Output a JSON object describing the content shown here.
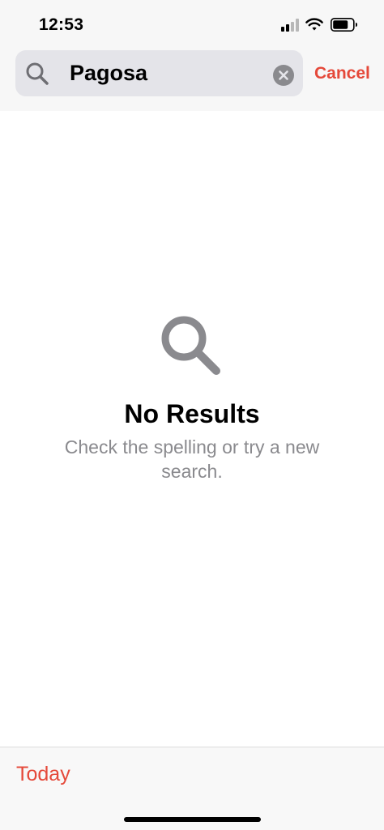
{
  "status_bar": {
    "time": "12:53"
  },
  "search": {
    "query": "Pagosa",
    "cancel_label": "Cancel"
  },
  "empty_state": {
    "icon": "search-icon",
    "title": "No Results",
    "message": "Check the spelling or try a new search."
  },
  "toolbar": {
    "today_label": "Today"
  },
  "colors": {
    "accent": "#e5493a",
    "secondary_text": "#8a8a8e",
    "search_field_bg": "#e4e4e9"
  }
}
